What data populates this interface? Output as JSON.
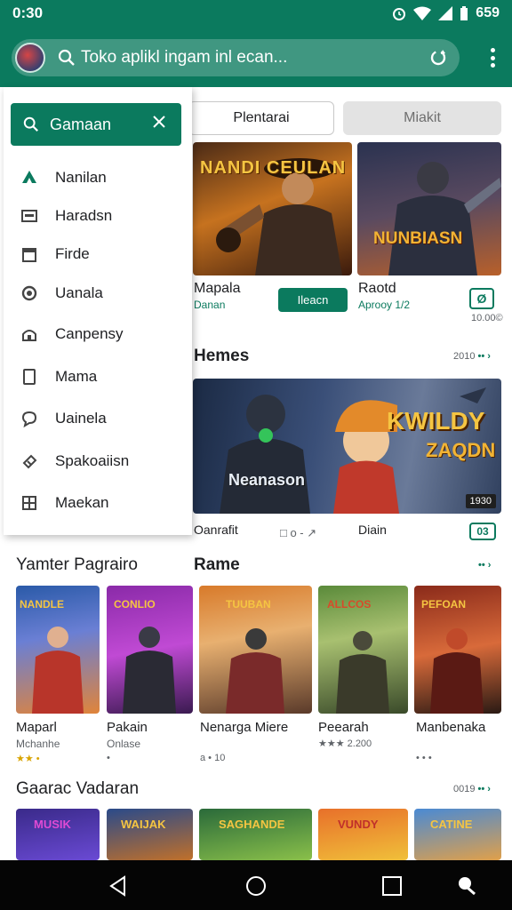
{
  "status": {
    "time": "0:30",
    "battery": "659"
  },
  "search": {
    "placeholder": "Toko aplikl ingam inl ecan..."
  },
  "chips": [
    "Plentarai",
    "Miakit"
  ],
  "featured": [
    {
      "title": "Mapala",
      "sub": "Danan",
      "button": "Ileacn",
      "art_text": "NANDI CEULAN"
    },
    {
      "title": "Raotd",
      "sub": "Aprooy  1/2",
      "button": "Ø",
      "meta": "10.00©",
      "art_text": "NUNBIASN"
    }
  ],
  "section1": {
    "title": "Hemes",
    "more": "2010",
    "arrow": "•• ›"
  },
  "banner": {
    "art_text1": "KWILDY",
    "art_text2": "ZAQDN",
    "art_text3": "Neanason",
    "badge": "1930",
    "left_title": "Oanrafit",
    "mid_meta": "□ o - ↗",
    "right_title": "Diain",
    "button": "03"
  },
  "section2": {
    "title_left": "Yamter Pagrairo",
    "title": "Rame",
    "arrow": "•• ›"
  },
  "games": [
    {
      "art": "NANDLE",
      "name": "Maparl",
      "dev": "Mchanhe",
      "rating": "★★  •"
    },
    {
      "art": "CONLIO",
      "name": "Pakain",
      "dev": "Onlase",
      "rating": "•"
    },
    {
      "art": "TUUBAN",
      "name": "Nenarga Miere",
      "dev": "",
      "rating": "a • 10"
    },
    {
      "art": "ALLCOS",
      "name": "Peearah",
      "dev": "",
      "rating": "★★★ 2.200"
    },
    {
      "art": "PEFOAN",
      "name": "Manbenaka",
      "dev": "",
      "rating": "• • •"
    }
  ],
  "section3": {
    "title": "Gaarac Vadaran",
    "more": "0019",
    "arrow": "•• ›"
  },
  "bottom_row_art": [
    "MUSIK",
    "WAIJAK",
    "SAGHANDE",
    "VUNDY",
    "CATINE"
  ],
  "drawer": {
    "search_label": "Gamaan",
    "items": [
      {
        "label": "Nanilan",
        "icon": "games-icon"
      },
      {
        "label": "Haradsn",
        "icon": "apps-icon"
      },
      {
        "label": "Firde",
        "icon": "movies-icon"
      },
      {
        "label": "Uanala",
        "icon": "books-icon"
      },
      {
        "label": "Canpensy",
        "icon": "account-icon"
      },
      {
        "label": "Mama",
        "icon": "library-icon"
      },
      {
        "label": "Uainela",
        "icon": "chat-icon"
      },
      {
        "label": "Spakoaiisn",
        "icon": "offers-icon"
      },
      {
        "label": "Maekan",
        "icon": "grid-icon"
      }
    ]
  },
  "colors": {
    "accent": "#0b7a5e"
  }
}
